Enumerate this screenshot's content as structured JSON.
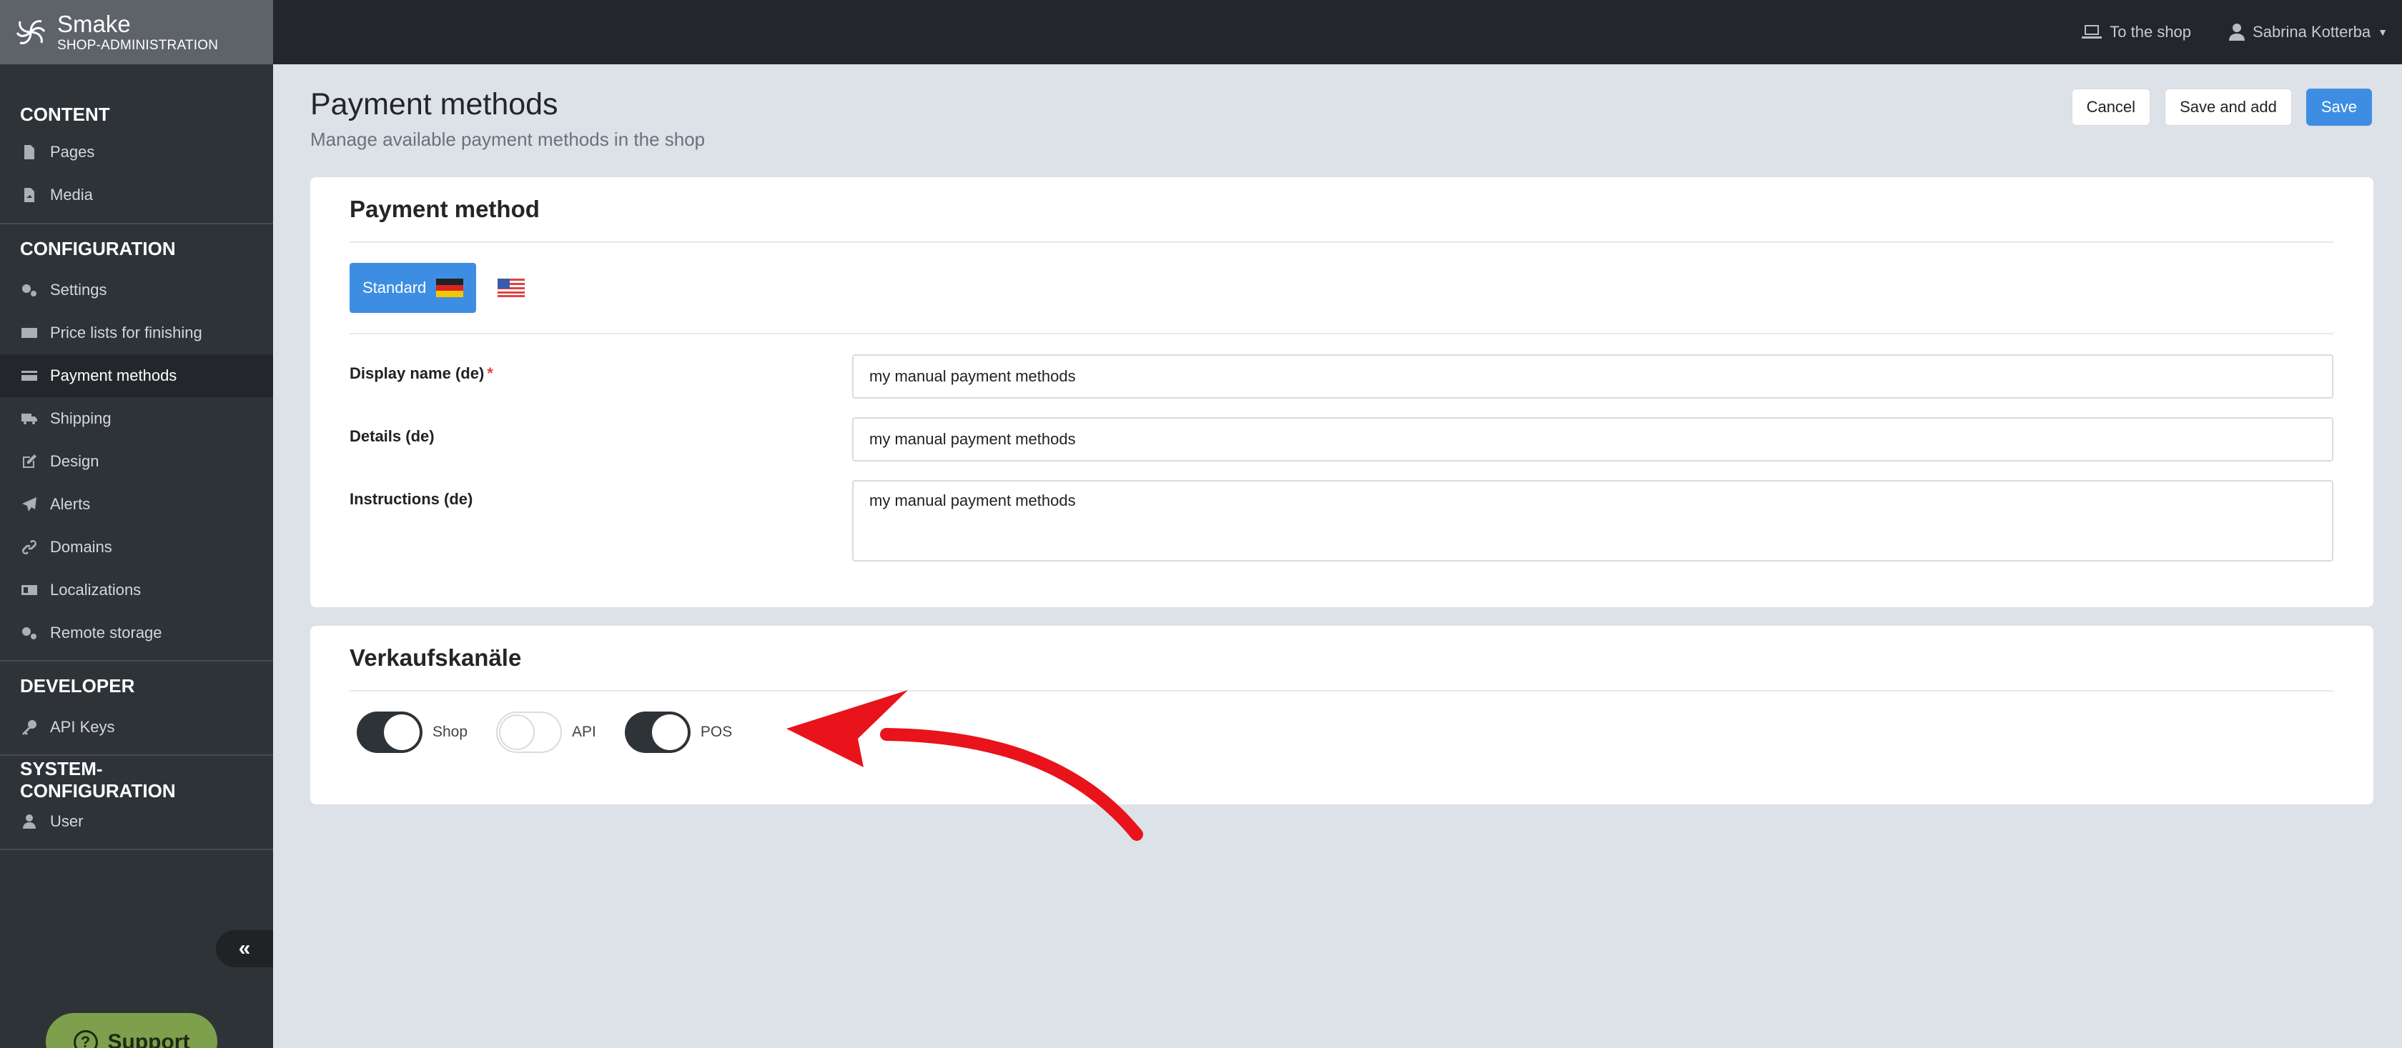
{
  "brand": {
    "name": "Smake",
    "sub": "SHOP-ADMINISTRATION"
  },
  "topbar": {
    "shop_link": "To the shop",
    "user_name": "Sabrina Kotterba"
  },
  "sidebar": {
    "sections": [
      {
        "heading": "CONTENT",
        "items": [
          {
            "label": "Pages",
            "icon": "page-icon"
          },
          {
            "label": "Media",
            "icon": "media-icon"
          }
        ]
      },
      {
        "heading": "CONFIGURATION",
        "items": [
          {
            "label": "Settings",
            "icon": "gears-icon"
          },
          {
            "label": "Price lists for finishing",
            "icon": "money-icon"
          },
          {
            "label": "Payment methods",
            "icon": "credit-card-icon",
            "active": true
          },
          {
            "label": "Shipping",
            "icon": "truck-icon"
          },
          {
            "label": "Design",
            "icon": "edit-icon"
          },
          {
            "label": "Alerts",
            "icon": "paper-plane-icon"
          },
          {
            "label": "Domains",
            "icon": "link-icon"
          },
          {
            "label": "Localizations",
            "icon": "language-icon"
          },
          {
            "label": "Remote storage",
            "icon": "gears-icon"
          }
        ]
      },
      {
        "heading": "DEVELOPER",
        "items": [
          {
            "label": "API Keys",
            "icon": "key-icon"
          }
        ]
      },
      {
        "heading": "SYSTEM-CONFIGURATION",
        "items": [
          {
            "label": "User",
            "icon": "user-icon"
          }
        ]
      }
    ],
    "collapse_label": "«",
    "support_label": "Support"
  },
  "header": {
    "title": "Payment methods",
    "subtitle": "Manage available payment methods in the shop",
    "cancel": "Cancel",
    "save_and_add": "Save and add",
    "save": "Save"
  },
  "payment_card": {
    "title": "Payment method",
    "tab_label": "Standard",
    "fields": {
      "display_name_label": "Display name (de)",
      "display_name_value": "my manual payment methods",
      "details_label": "Details (de)",
      "details_value": "my manual payment methods",
      "instructions_label": "Instructions (de)",
      "instructions_value": "my manual payment methods"
    }
  },
  "channels_card": {
    "title": "Verkaufskanäle",
    "toggles": [
      {
        "label": "Shop",
        "on": true
      },
      {
        "label": "API",
        "on": false
      },
      {
        "label": "POS",
        "on": true
      }
    ]
  },
  "colors": {
    "accent": "#3d8ee3",
    "sidebar": "#2e3338",
    "annotation_arrow": "#e8131b"
  }
}
